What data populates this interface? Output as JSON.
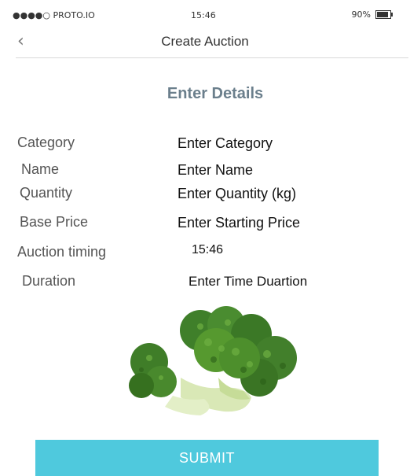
{
  "status_bar": {
    "carrier": "●●●●○ PROTO.IO",
    "time": "15:46",
    "battery": "90%",
    "battery_level": 0.9
  },
  "navbar": {
    "back_icon": "chevron-left-icon",
    "title": "Create Auction"
  },
  "form": {
    "heading": "Enter Details",
    "fields": [
      {
        "label": "Category",
        "value": "Enter Category"
      },
      {
        "label": "Name",
        "value": "Enter Name"
      },
      {
        "label": "Quantity",
        "value": "Enter Quantity (kg)"
      },
      {
        "label": "Base Price",
        "value": "Enter Starting Price"
      },
      {
        "label": "Auction timing",
        "value": "15:46"
      },
      {
        "label": "Duration",
        "value": "Enter Time Duartion"
      }
    ]
  },
  "image": {
    "subject": "broccoli-image"
  },
  "submit_label": "SUBMIT",
  "colors": {
    "accent": "#4fc9dd",
    "heading": "#6b7f8c",
    "divider": "#d9d9d9"
  }
}
